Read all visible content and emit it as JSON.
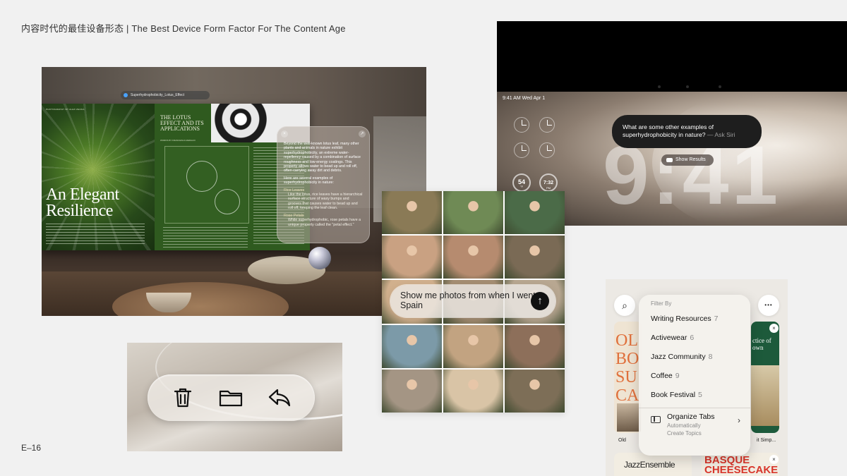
{
  "slide": {
    "title": "内容时代的最佳设备形态 | The Best Device Form Factor For The Content Age",
    "page_number": "E–16"
  },
  "vision_panel": {
    "url_bar": "Superhydrophobicity_Lotus_Effect",
    "magazine": {
      "credit": "PHOTOGRAPHY BY ALEX ZECKA",
      "headline_line1": "An Elegant",
      "headline_line2": "Resilience",
      "right_title": "THE LOTUS EFFECT AND ITS APPLICATIONS",
      "byline": "WORDS BY FRANCESCA MERALDI"
    },
    "siri_card": {
      "close_icon": "×",
      "expand_icon": "↗",
      "p1": "Beyond the well-known lotus leaf, many other plants and animals in nature exhibit superhydrophobicity, an extreme water-repellency caused by a combination of surface roughness and low-energy coatings. This property allows water to bead up and roll off, often carrying away dirt and debris.",
      "p2": "Here are several examples of superhydrophobicity in nature:",
      "item1_title": "Rice Leaves",
      "item1_text": "Like the lotus, rice leaves have a hierarchical surface structure of waxy bumps and grooves that causes water to bead up and roll off, keeping the leaf clean.",
      "item2_title": "Rose Petals",
      "item2_text": "While superhydrophobic, rose petals have a unique property called the \"petal effect.\""
    }
  },
  "iphone_panel": {
    "status_time": "9:41 AM  Wed Apr 1",
    "widget_left": {
      "value": "54",
      "sub": "°F"
    },
    "widget_right": {
      "value": "7:32",
      "sub": "PM"
    },
    "big_time": "9:41",
    "siri_query": "What are some other examples of superhydrophobicity in nature?",
    "siri_suffix": "— Ask Siri",
    "show_results": "Show Results"
  },
  "photos_panel": {
    "query": "Show me photos from when I went to Spain",
    "send_icon": "↑",
    "tile_colors": [
      "#8a7a56",
      "#6f8a55",
      "#4b6b48",
      "#c9a182",
      "#b68b6f",
      "#7a6a55",
      "#d1b08d",
      "#a58e73",
      "#b8a791",
      "#7c9aa8",
      "#c2a381",
      "#8d6f5a",
      "#a49584",
      "#d9c4a6",
      "#7d6e57"
    ]
  },
  "toolbar_panel": {
    "icons": [
      "trash-icon",
      "folder-icon",
      "reply-icon"
    ]
  },
  "safari_panel": {
    "search_icon": "⌕",
    "more_icon": "•••",
    "filter_header": "Filter By",
    "filters": [
      {
        "label": "Writing Resources",
        "count": "7"
      },
      {
        "label": "Activewear",
        "count": "6"
      },
      {
        "label": "Jazz Community",
        "count": "8"
      },
      {
        "label": "Coffee",
        "count": "9"
      },
      {
        "label": "Book Festival",
        "count": "5"
      }
    ],
    "organize_title": "Organize Tabs",
    "organize_sub1": "Automatically",
    "organize_sub2": "Create Topics",
    "chevron": "›",
    "left_tab_text": "OL BO SU CA",
    "left_tab_caption": "Old",
    "right_tab_text": "ctice of own",
    "right_tab_caption": "it Simp...",
    "bottom_left_tab": "JazzEnsemble",
    "bottom_right_tab": "BASQUE CHEESECAKE",
    "close_icon": "×"
  }
}
